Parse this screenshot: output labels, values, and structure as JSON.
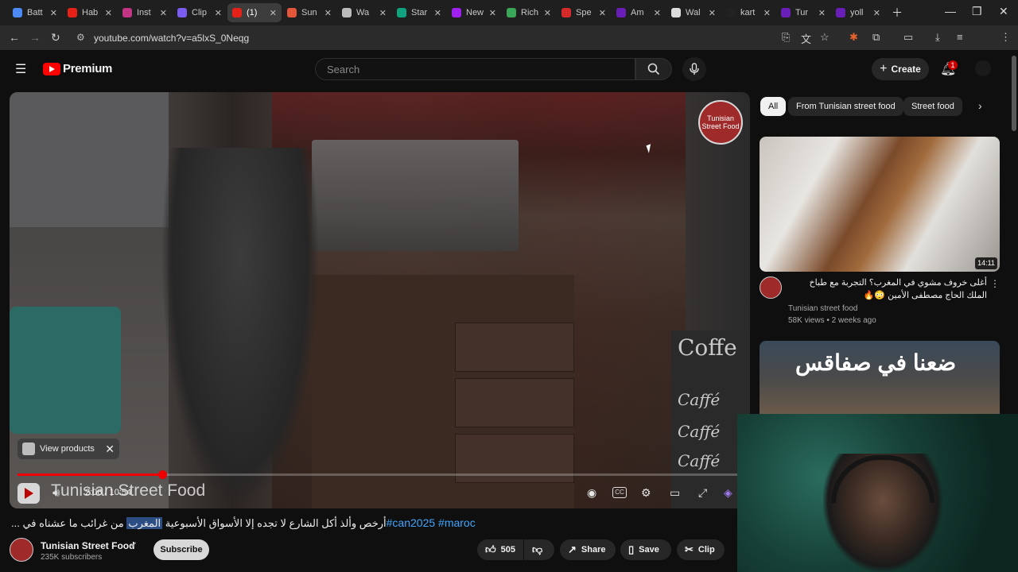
{
  "browser": {
    "tabs": [
      {
        "label": "Batt",
        "fav_color": "#4c8bf5"
      },
      {
        "label": "Hab",
        "fav_color": "#e62117"
      },
      {
        "label": "Inst",
        "fav_color": "#c13584"
      },
      {
        "label": "Clip",
        "fav_color": "#7b5cf0"
      },
      {
        "label": "(1)",
        "fav_color": "#e62117",
        "active": true
      },
      {
        "label": "Sun",
        "fav_color": "#e3563a"
      },
      {
        "label": "Wa",
        "fav_color": "#bbbbbb"
      },
      {
        "label": "Star",
        "fav_color": "#10a37f"
      },
      {
        "label": "New",
        "fav_color": "#a020f0"
      },
      {
        "label": "Rich",
        "fav_color": "#3aa657"
      },
      {
        "label": "Spe",
        "fav_color": "#d42a2a"
      },
      {
        "label": "Am",
        "fav_color": "#6a1eb8"
      },
      {
        "label": "Wal",
        "fav_color": "#dddddd"
      },
      {
        "label": "kart",
        "fav_color": "#222222"
      },
      {
        "label": "Tur",
        "fav_color": "#6a1eb8"
      },
      {
        "label": "yoll",
        "fav_color": "#6a1eb8"
      }
    ],
    "url": "youtube.com/watch?v=a5lxS_0Neqg"
  },
  "yt_header": {
    "brand": "Premium",
    "search_placeholder": "Search",
    "create_label": "Create",
    "notif_count": "1"
  },
  "player": {
    "brand_badge": "Tunisian Street Food",
    "cafe_lines": [
      "Coffe",
      "Caffé",
      "Caffé",
      "Caffé"
    ],
    "view_products_label": "View products",
    "channel_watermark": "Tunisian Street Food",
    "time_display": "2:06 / 10:54",
    "progress_fraction": 0.2
  },
  "video": {
    "title_main": "من غرائب ما عشناه في",
    "title_highlight": "المغرب",
    "title_rest": "... أرخص وألذ أكل الشارع لا تجده إلا الأسواق الأسبوعية",
    "tags": "#can2025 #maroc"
  },
  "channel": {
    "name": "Tunisian Street Food",
    "subs": "235K subscribers",
    "subscribe_label": "Subscribe"
  },
  "actions": {
    "likes": "505",
    "share_label": "Share",
    "save_label": "Save",
    "clip_label": "Clip"
  },
  "chips": [
    "All",
    "From Tunisian street food",
    "Street food"
  ],
  "recommendations": [
    {
      "title": "أغلى خروف مشوي في المغرب؟ التجربة مع طباخ الملك الحاج مصطفى الأمين 😳🔥",
      "channel": "Tunisian street food",
      "meta": "58K views • 2 weeks ago",
      "duration": "14:11"
    },
    {
      "thumb_text": "ضعنا في صفاقس"
    }
  ]
}
